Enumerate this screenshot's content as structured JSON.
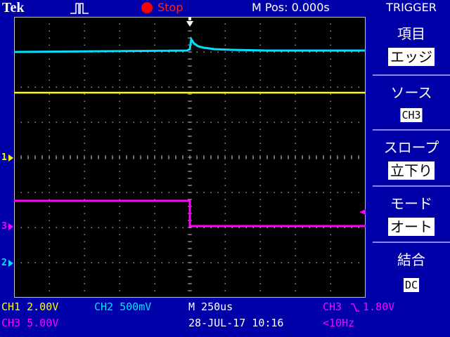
{
  "header": {
    "brand": "Tek",
    "acq_state": "Stop",
    "m_pos": "M Pos: 0.000s",
    "menu_title": "TRIGGER"
  },
  "colors": {
    "ch1": "#00e0ff",
    "ch2": "#ffff00",
    "ch3": "#ff00ff",
    "grid": "#c0c0c0",
    "background": "#0000a8",
    "stop": "#ff0000"
  },
  "markers": {
    "ch1": "1",
    "ch3": "3",
    "ch2": "2"
  },
  "menu": [
    {
      "label": "項目",
      "value": "エッジ"
    },
    {
      "label": "ソース",
      "value": "CH3"
    },
    {
      "label": "スロープ",
      "value": "立下り"
    },
    {
      "label": "モード",
      "value": "オート"
    },
    {
      "label": "結合",
      "value": "DC"
    }
  ],
  "status": {
    "ch1": "CH1  2.00V",
    "ch2": "CH2  500mV",
    "ch3": "CH3  5.00V",
    "timebase": "M 250us",
    "date": "28-JUL-17 10:16",
    "trig_src": "CH3",
    "trig_level": "1.80V",
    "freq": "<10Hz"
  }
}
